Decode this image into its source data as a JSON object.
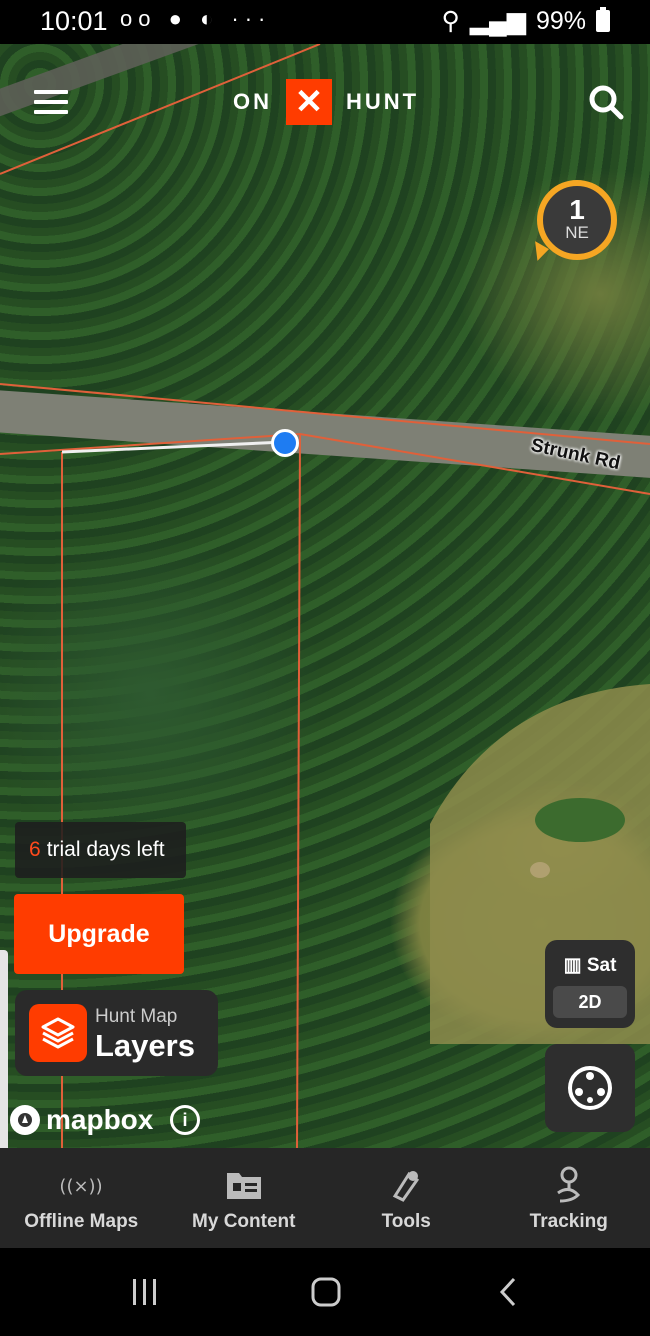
{
  "status_bar": {
    "time": "10:01",
    "left_icons": "ᴏᴏ ● ◐ ···",
    "battery_text": "99%"
  },
  "header": {
    "logo_left": "ON",
    "logo_mark": "✕",
    "logo_right": "HUNT"
  },
  "map": {
    "road_label": "Strunk Rd",
    "compass": {
      "count": "1",
      "direction": "NE"
    }
  },
  "trial": {
    "days": "6",
    "text": "trial days left"
  },
  "upgrade_label": "Upgrade",
  "layers": {
    "subtitle": "Hunt Map",
    "title": "Layers"
  },
  "attribution": {
    "brand": "mapbox",
    "info": "i"
  },
  "basemap": {
    "type": "Sat",
    "mode": "2D"
  },
  "bottom_nav": {
    "offline_maps": "Offline Maps",
    "my_content": "My Content",
    "tools": "Tools",
    "tracking": "Tracking"
  },
  "colors": {
    "brand": "#ff3c00",
    "compass_ring": "#f5a623",
    "location": "#1e7cf2"
  }
}
